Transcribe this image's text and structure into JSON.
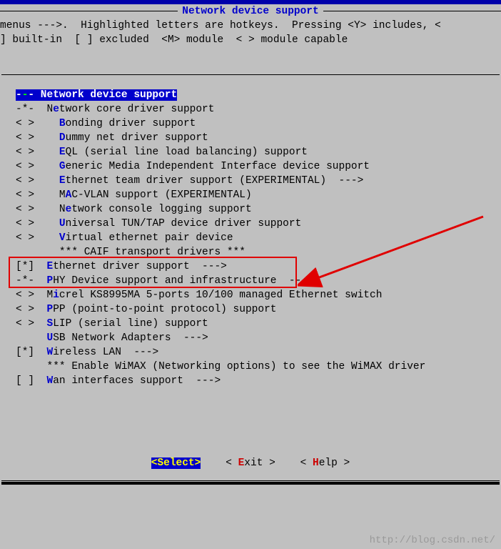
{
  "title": "Network device support",
  "help_line1": "menus --->.  Highlighted letters are hotkeys.  Pressing <Y> includes, <",
  "help_line2": "] built-in  [ ] excluded  <M> module  < > module capable",
  "menu_header_prefix": "-",
  "menu_header_text": "- Network device support",
  "items": [
    {
      "state": "-*-",
      "indent": "  ",
      "hot": "e",
      "pre": "N",
      "post": "twork core driver support"
    },
    {
      "state": "< >",
      "indent": "    ",
      "hot": "B",
      "pre": "",
      "post": "onding driver support"
    },
    {
      "state": "< >",
      "indent": "    ",
      "hot": "D",
      "pre": "",
      "post": "ummy net driver support"
    },
    {
      "state": "< >",
      "indent": "    ",
      "hot": "E",
      "pre": "",
      "post": "QL (serial line load balancing) support"
    },
    {
      "state": "< >",
      "indent": "    ",
      "hot": "G",
      "pre": "",
      "post": "eneric Media Independent Interface device support"
    },
    {
      "state": "< >",
      "indent": "    ",
      "hot": "E",
      "pre": "",
      "post": "thernet team driver support (EXPERIMENTAL)  --->"
    },
    {
      "state": "< >",
      "indent": "    ",
      "hot": "A",
      "pre": "M",
      "post": "C-VLAN support (EXPERIMENTAL)"
    },
    {
      "state": "< >",
      "indent": "    ",
      "hot": "e",
      "pre": "N",
      "post": "twork console logging support"
    },
    {
      "state": "< >",
      "indent": "    ",
      "hot": "U",
      "pre": "",
      "post": "niversal TUN/TAP device driver support"
    },
    {
      "state": "< >",
      "indent": "    ",
      "hot": "V",
      "pre": "",
      "post": "irtual ethernet pair device"
    },
    {
      "state": "   ",
      "indent": "    ",
      "hot": "",
      "pre": "*** CAIF transport drivers ***",
      "post": ""
    },
    {
      "state": "[*]",
      "indent": "  ",
      "hot": "E",
      "pre": "",
      "post": "thernet driver support  --->"
    },
    {
      "state": "-*-",
      "indent": "  ",
      "hot": "P",
      "pre": "",
      "post": "HY Device support and infrastructure  --->"
    },
    {
      "state": "< >",
      "indent": "  ",
      "hot": "i",
      "pre": "M",
      "post": "crel KS8995MA 5-ports 10/100 managed Ethernet switch"
    },
    {
      "state": "< >",
      "indent": "  ",
      "hot": "P",
      "pre": "",
      "post": "PP (point-to-point protocol) support"
    },
    {
      "state": "< >",
      "indent": "  ",
      "hot": "S",
      "pre": "",
      "post": "LIP (serial line) support"
    },
    {
      "state": "   ",
      "indent": "  ",
      "hot": "U",
      "pre": "",
      "post": "SB Network Adapters  --->"
    },
    {
      "state": "[*]",
      "indent": "  ",
      "hot": "W",
      "pre": "",
      "post": "ireless LAN  --->"
    },
    {
      "state": "   ",
      "indent": "  ",
      "hot": "",
      "pre": "*** Enable WiMAX (Networking options) to see the WiMAX driver",
      "post": ""
    },
    {
      "state": "[ ]",
      "indent": "  ",
      "hot": "W",
      "pre": "",
      "post": "an interfaces support  --->"
    }
  ],
  "buttons": {
    "select": "<Select>",
    "exit_pre": "< ",
    "exit_hot": "E",
    "exit_post": "xit >",
    "help_pre": "< ",
    "help_hot": "H",
    "help_post": "elp >"
  },
  "watermark": "http://blog.csdn.net/"
}
